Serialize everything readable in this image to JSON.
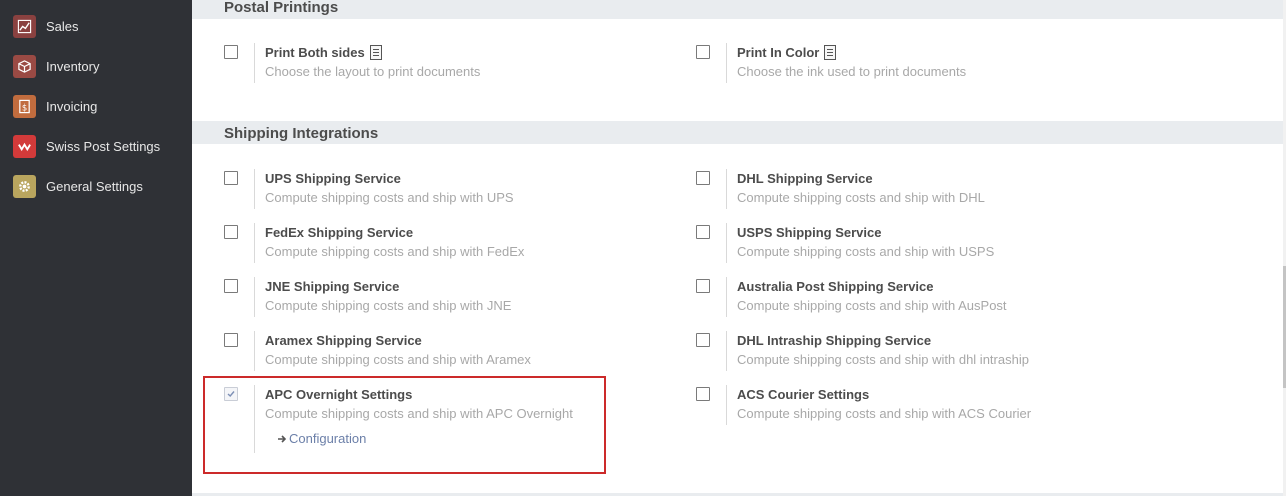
{
  "sidebar": {
    "items": [
      {
        "label": "Sales",
        "icon": "sales-chart-icon",
        "color": "#8a4140"
      },
      {
        "label": "Inventory",
        "icon": "inventory-box-icon",
        "color": "#9a4a44"
      },
      {
        "label": "Invoicing",
        "icon": "invoice-icon",
        "color": "#c16c3e"
      },
      {
        "label": "Swiss Post Settings",
        "icon": "swiss-post-icon",
        "color": "#d33a3a"
      },
      {
        "label": "General Settings",
        "icon": "gear-icon",
        "color": "#b9a55e"
      }
    ]
  },
  "sections": {
    "postal": {
      "title": "Postal Printings",
      "settings": [
        {
          "title": "Print Both sides",
          "desc": "Choose the layout to print documents",
          "checked": false
        },
        {
          "title": "Print In Color",
          "desc": "Choose the ink used to print documents",
          "checked": false
        }
      ]
    },
    "shipping": {
      "title": "Shipping Integrations",
      "settings": [
        {
          "title": "UPS Shipping Service",
          "desc": "Compute shipping costs and ship with UPS",
          "checked": false
        },
        {
          "title": "DHL Shipping Service",
          "desc": "Compute shipping costs and ship with DHL",
          "checked": false
        },
        {
          "title": "FedEx Shipping Service",
          "desc": "Compute shipping costs and ship with FedEx",
          "checked": false
        },
        {
          "title": "USPS Shipping Service",
          "desc": "Compute shipping costs and ship with USPS",
          "checked": false
        },
        {
          "title": "JNE Shipping Service",
          "desc": "Compute shipping costs and ship with JNE",
          "checked": false
        },
        {
          "title": "Australia Post Shipping Service",
          "desc": "Compute shipping costs and ship with AusPost",
          "checked": false
        },
        {
          "title": "Aramex Shipping Service",
          "desc": "Compute shipping costs and ship with Aramex",
          "checked": false
        },
        {
          "title": "DHL Intraship Shipping Service",
          "desc": "Compute shipping costs and ship with dhl intraship",
          "checked": false
        },
        {
          "title": "APC Overnight Settings",
          "desc": "Compute shipping costs and ship with APC Overnight",
          "checked": true,
          "link": "Configuration"
        },
        {
          "title": "ACS Courier Settings",
          "desc": "Compute shipping costs and ship with ACS Courier",
          "checked": false
        }
      ]
    }
  }
}
